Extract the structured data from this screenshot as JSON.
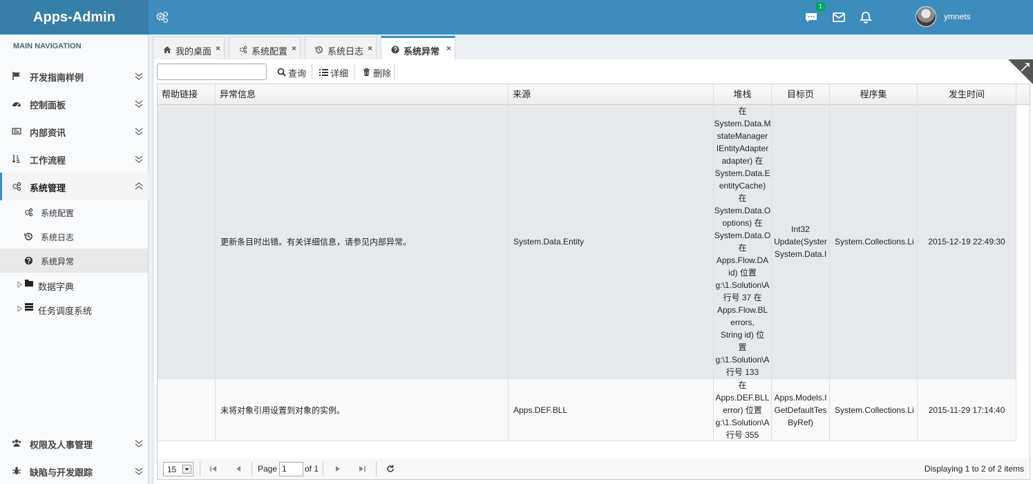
{
  "header": {
    "logo": "Apps-Admin",
    "messages_badge": "1",
    "username": "ymnets"
  },
  "sidebar": {
    "header": "MAIN NAVIGATION",
    "menu": [
      {
        "label": "开发指南样例",
        "icon": "flag-icon"
      },
      {
        "label": "控制面板",
        "icon": "dashboard-icon"
      },
      {
        "label": "内部资讯",
        "icon": "newspaper-icon"
      },
      {
        "label": "工作流程",
        "icon": "sort-icon"
      },
      {
        "label": "系统管理",
        "icon": "cogs-icon",
        "expanded": true
      },
      {
        "label": "权限及人事管理",
        "icon": "users-icon"
      },
      {
        "label": "缺陷与开发跟踪",
        "icon": "bug-icon"
      }
    ],
    "submenu": [
      {
        "label": "系统配置",
        "icon": "cogs-icon"
      },
      {
        "label": "系统日志",
        "icon": "history-icon"
      },
      {
        "label": "系统异常",
        "icon": "question-circle-icon",
        "active": true
      }
    ],
    "tree": [
      {
        "label": "数据字典",
        "icon": "folder-icon"
      },
      {
        "label": "任务调度系统",
        "icon": "server-icon"
      }
    ]
  },
  "tabs": [
    {
      "label": "我的桌面",
      "icon": "home-icon"
    },
    {
      "label": "系统配置",
      "icon": "cogs-icon"
    },
    {
      "label": "系统日志",
      "icon": "history-icon"
    },
    {
      "label": "系统异常",
      "icon": "question-circle-icon",
      "selected": true
    }
  ],
  "toolbar": {
    "search_value": "",
    "query_label": "查询",
    "detail_label": "详细",
    "delete_label": "删除"
  },
  "grid": {
    "columns": [
      "帮助链接",
      "异常信息",
      "来源",
      "堆栈",
      "目标页",
      "程序集",
      "发生时间"
    ],
    "rows": [
      {
        "help": "",
        "message": "更新条目时出错。有关详细信息，请参见内部异常。",
        "source": "System.Data.Entity",
        "stack": [
          "在",
          "System.Data.M",
          "stateManager",
          "IEntityAdapter",
          "adapter) 在",
          "System.Data.E",
          "entityCache)",
          "在",
          "System.Data.O",
          "options) 在",
          "System.Data.O",
          "在",
          "Apps.Flow.DA",
          "id) 位置",
          "g:\\1.Solution\\A",
          "行号 37 在",
          "Apps.Flow.BL",
          "errors,",
          "String id) 位",
          "置",
          "g:\\1.Solution\\A",
          "行号 133"
        ],
        "target": [
          "Int32",
          "Update(Syster",
          "System.Data.I"
        ],
        "assembly": "System.Collections.Li",
        "time": "2015-12-19 22:49:30"
      },
      {
        "help": "",
        "message": "未将对象引用设置到对象的实例。",
        "source": "Apps.DEF.BLL",
        "stack": [
          "在",
          "Apps.DEF.BLL",
          "error) 位置",
          "g:\\1.Solution\\A",
          "行号 355"
        ],
        "target": [
          "Apps.Models.I",
          "GetDefaultTes",
          "ByRef)"
        ],
        "assembly": "System.Collections.Li",
        "time": "2015-11-29 17:14:40"
      }
    ]
  },
  "pager": {
    "page_size": "15",
    "page_label": "Page",
    "page_value": "1",
    "of_label": "of 1",
    "display_text": "Displaying 1 to 2 of 2 items"
  }
}
